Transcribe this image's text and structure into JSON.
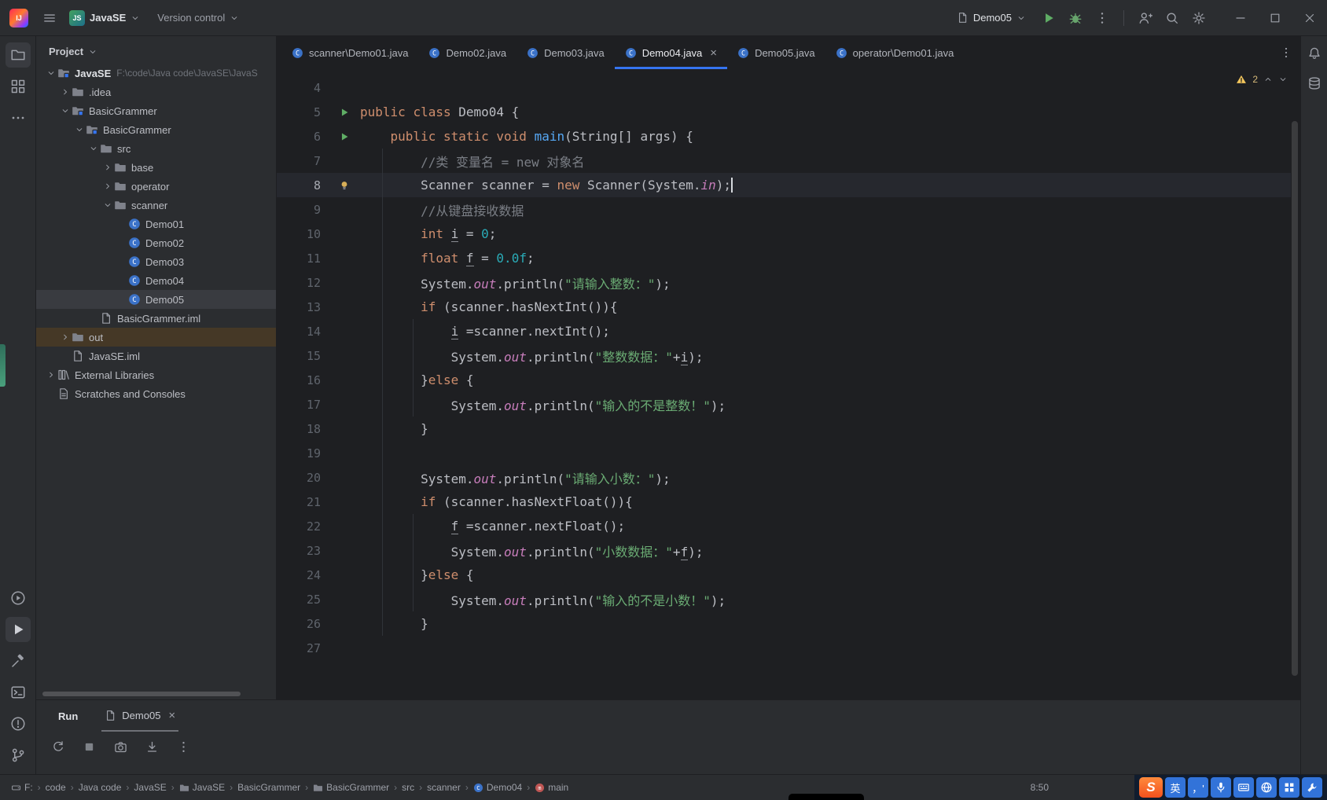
{
  "colors": {
    "accent": "#3574f0",
    "editor_bg": "#1e1f22",
    "panel_bg": "#2b2d30",
    "keyword": "#cf8e6d",
    "string": "#6aab73",
    "number": "#2aacb8",
    "comment": "#7a7e85",
    "field": "#c77dbb",
    "method": "#56a8f5",
    "run_green": "#5fad65",
    "warning": "#f2c55c",
    "selection": "#393b40",
    "out_highlight": "#453826"
  },
  "app": {
    "titlebar": {
      "logo": "IJ",
      "project_badge": "JS",
      "project_name": "JavaSE",
      "vcs_label": "Version control",
      "run_config": "Demo05",
      "right_icons": [
        "add-user",
        "search",
        "settings"
      ]
    }
  },
  "left_strip": {
    "top": [
      {
        "name": "project-folder",
        "selected": true
      },
      {
        "name": "structure"
      },
      {
        "name": "more"
      }
    ],
    "bottom": [
      {
        "name": "services"
      },
      {
        "name": "run",
        "selected": true
      },
      {
        "name": "build"
      },
      {
        "name": "terminal"
      },
      {
        "name": "problems"
      },
      {
        "name": "version-control"
      }
    ]
  },
  "right_strip": {
    "icons": [
      "notifications",
      "database"
    ]
  },
  "project_panel": {
    "title": "Project",
    "tree": [
      {
        "label": "JavaSE",
        "sub": "F:\\code\\Java code\\JavaSE\\JavaS",
        "depth": 0,
        "chev": "down",
        "icon": "module",
        "bold": true
      },
      {
        "label": ".idea",
        "depth": 1,
        "chev": "right",
        "icon": "folder"
      },
      {
        "label": "BasicGrammer",
        "depth": 1,
        "chev": "down",
        "icon": "module"
      },
      {
        "label": "BasicGrammer",
        "depth": 2,
        "chev": "down",
        "icon": "module"
      },
      {
        "label": "src",
        "depth": 3,
        "chev": "down",
        "icon": "folder"
      },
      {
        "label": "base",
        "depth": 4,
        "chev": "right",
        "icon": "folder"
      },
      {
        "label": "operator",
        "depth": 4,
        "chev": "right",
        "icon": "folder"
      },
      {
        "label": "scanner",
        "depth": 4,
        "chev": "down",
        "icon": "folder"
      },
      {
        "label": "Demo01",
        "depth": 5,
        "icon": "class"
      },
      {
        "label": "Demo02",
        "depth": 5,
        "icon": "class"
      },
      {
        "label": "Demo03",
        "depth": 5,
        "icon": "class"
      },
      {
        "label": "Demo04",
        "depth": 5,
        "icon": "class"
      },
      {
        "label": "Demo05",
        "depth": 5,
        "icon": "class",
        "selected": true
      },
      {
        "label": "BasicGrammer.iml",
        "depth": 3,
        "icon": "file"
      },
      {
        "label": "out",
        "depth": 1,
        "chev": "right",
        "icon": "folder",
        "highlight": true
      },
      {
        "label": "JavaSE.iml",
        "depth": 1,
        "icon": "file"
      },
      {
        "label": "External Libraries",
        "depth": 0,
        "chev": "right",
        "icon": "library"
      },
      {
        "label": "Scratches and Consoles",
        "depth": 0,
        "icon": "scratch"
      }
    ]
  },
  "editor": {
    "tabs": [
      {
        "label": "scanner\\Demo01.java"
      },
      {
        "label": "Demo02.java"
      },
      {
        "label": "Demo03.java"
      },
      {
        "label": "Demo04.java",
        "active": true,
        "close": true
      },
      {
        "label": "Demo05.java"
      },
      {
        "label": "operator\\Demo01.java"
      }
    ],
    "inspections": {
      "warnings": "2"
    },
    "lines": [
      {
        "n": 4,
        "seg": []
      },
      {
        "n": 5,
        "g": "run",
        "seg": [
          [
            "k",
            "public"
          ],
          [
            "p",
            " "
          ],
          [
            "k",
            "class"
          ],
          [
            "p",
            " Demo04 {"
          ]
        ]
      },
      {
        "n": 6,
        "g": "run",
        "seg": [
          [
            "p",
            "    "
          ],
          [
            "k",
            "public"
          ],
          [
            "p",
            " "
          ],
          [
            "k",
            "static"
          ],
          [
            "p",
            " "
          ],
          [
            "k",
            "void"
          ],
          [
            "p",
            " "
          ],
          [
            "m",
            "main"
          ],
          [
            "p",
            "(String[] args) {"
          ]
        ]
      },
      {
        "n": 7,
        "seg": [
          [
            "p",
            "        "
          ],
          [
            "c",
            "//类 变量名 = new 对象名"
          ]
        ]
      },
      {
        "n": 8,
        "g": "bulb",
        "cur": true,
        "caret": true,
        "seg": [
          [
            "p",
            "        Scanner scanner = "
          ],
          [
            "k",
            "new"
          ],
          [
            "p",
            " Scanner(System."
          ],
          [
            "f",
            "in"
          ],
          [
            "p",
            ");"
          ]
        ]
      },
      {
        "n": 9,
        "seg": [
          [
            "p",
            "        "
          ],
          [
            "c",
            "//从键盘接收数据"
          ]
        ]
      },
      {
        "n": 10,
        "seg": [
          [
            "p",
            "        "
          ],
          [
            "k",
            "int"
          ],
          [
            "p",
            " "
          ],
          [
            "u",
            "i"
          ],
          [
            "p",
            " = "
          ],
          [
            "d",
            "0"
          ],
          [
            "p",
            ";"
          ]
        ]
      },
      {
        "n": 11,
        "seg": [
          [
            "p",
            "        "
          ],
          [
            "k",
            "float"
          ],
          [
            "p",
            " "
          ],
          [
            "u",
            "f"
          ],
          [
            "p",
            " = "
          ],
          [
            "d",
            "0.0f"
          ],
          [
            "p",
            ";"
          ]
        ]
      },
      {
        "n": 12,
        "seg": [
          [
            "p",
            "        System."
          ],
          [
            "f",
            "out"
          ],
          [
            "p",
            ".println("
          ],
          [
            "s",
            "\"请输入整数：\""
          ],
          [
            "p",
            ");"
          ]
        ]
      },
      {
        "n": 13,
        "seg": [
          [
            "p",
            "        "
          ],
          [
            "k",
            "if"
          ],
          [
            "p",
            " (scanner.hasNextInt()){"
          ]
        ]
      },
      {
        "n": 14,
        "seg": [
          [
            "p",
            "            "
          ],
          [
            "u",
            "i"
          ],
          [
            "p",
            " =scanner.nextInt();"
          ]
        ]
      },
      {
        "n": 15,
        "seg": [
          [
            "p",
            "            System."
          ],
          [
            "f",
            "out"
          ],
          [
            "p",
            ".println("
          ],
          [
            "s",
            "\"整数数据：\""
          ],
          [
            "p",
            "+"
          ],
          [
            "u",
            "i"
          ],
          [
            "p",
            ");"
          ]
        ]
      },
      {
        "n": 16,
        "seg": [
          [
            "p",
            "        }"
          ],
          [
            "k",
            "else"
          ],
          [
            "p",
            " {"
          ]
        ]
      },
      {
        "n": 17,
        "seg": [
          [
            "p",
            "            System."
          ],
          [
            "f",
            "out"
          ],
          [
            "p",
            ".println("
          ],
          [
            "s",
            "\"输入的不是整数！\""
          ],
          [
            "p",
            ");"
          ]
        ]
      },
      {
        "n": 18,
        "seg": [
          [
            "p",
            "        }"
          ]
        ]
      },
      {
        "n": 19,
        "seg": []
      },
      {
        "n": 20,
        "seg": [
          [
            "p",
            "        System."
          ],
          [
            "f",
            "out"
          ],
          [
            "p",
            ".println("
          ],
          [
            "s",
            "\"请输入小数：\""
          ],
          [
            "p",
            ");"
          ]
        ]
      },
      {
        "n": 21,
        "seg": [
          [
            "p",
            "        "
          ],
          [
            "k",
            "if"
          ],
          [
            "p",
            " (scanner.hasNextFloat()){"
          ]
        ]
      },
      {
        "n": 22,
        "seg": [
          [
            "p",
            "            "
          ],
          [
            "u",
            "f"
          ],
          [
            "p",
            " =scanner.nextFloat();"
          ]
        ]
      },
      {
        "n": 23,
        "seg": [
          [
            "p",
            "            System."
          ],
          [
            "f",
            "out"
          ],
          [
            "p",
            ".println("
          ],
          [
            "s",
            "\"小数数据：\""
          ],
          [
            "p",
            "+"
          ],
          [
            "u",
            "f"
          ],
          [
            "p",
            ");"
          ]
        ]
      },
      {
        "n": 24,
        "seg": [
          [
            "p",
            "        }"
          ],
          [
            "k",
            "else"
          ],
          [
            "p",
            " {"
          ]
        ]
      },
      {
        "n": 25,
        "seg": [
          [
            "p",
            "            System."
          ],
          [
            "f",
            "out"
          ],
          [
            "p",
            ".println("
          ],
          [
            "s",
            "\"输入的不是小数！\""
          ],
          [
            "p",
            ");"
          ]
        ]
      },
      {
        "n": 26,
        "seg": [
          [
            "p",
            "        }"
          ]
        ]
      },
      {
        "n": 27,
        "seg": []
      }
    ]
  },
  "run_panel": {
    "title": "Run",
    "tab": "Demo05",
    "toolbar": [
      "rerun",
      "stop",
      "screenshot",
      "scroll_end",
      "kebab"
    ]
  },
  "status_bar": {
    "crumbs": [
      {
        "t": "F:",
        "icon": "drive"
      },
      {
        "t": "code"
      },
      {
        "t": "Java code"
      },
      {
        "t": "JavaSE"
      },
      {
        "t": "JavaSE",
        "icon": "folder"
      },
      {
        "t": "BasicGrammer"
      },
      {
        "t": "BasicGrammer",
        "icon": "folder"
      },
      {
        "t": "src"
      },
      {
        "t": "scanner"
      },
      {
        "t": "Demo04",
        "icon": "class"
      },
      {
        "t": "main",
        "icon": "method"
      }
    ],
    "caret_pos": "8:50"
  },
  "ime": {
    "logo": "S",
    "tiles": [
      {
        "t": "英"
      },
      {
        "t": "，'"
      },
      {
        "icon": "mic"
      },
      {
        "icon": "keyboard"
      },
      {
        "icon": "globe"
      },
      {
        "icon": "gridtile"
      },
      {
        "icon": "wrench"
      }
    ]
  }
}
